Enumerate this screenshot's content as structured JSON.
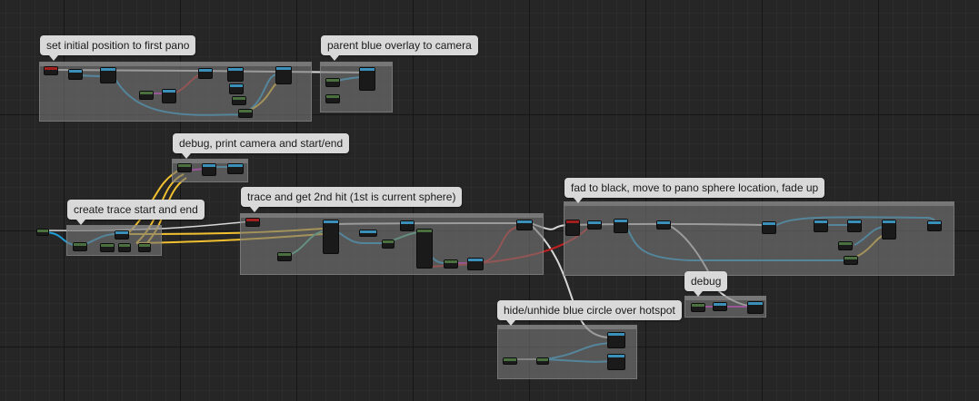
{
  "comments": [
    {
      "id": "set-initial-position",
      "label": "set initial position to first pano"
    },
    {
      "id": "parent-blue-overlay",
      "label": "parent blue overlay to camera"
    },
    {
      "id": "debug-print-camera",
      "label": "debug, print camera and start/end"
    },
    {
      "id": "create-trace",
      "label": "create trace start and end"
    },
    {
      "id": "trace-2nd-hit",
      "label": "trace and get 2nd hit (1st is current sphere)"
    },
    {
      "id": "fade-to-black",
      "label": "fad to black, move to pano sphere location, fade up"
    },
    {
      "id": "debug",
      "label": "debug"
    },
    {
      "id": "hide-unhide",
      "label": "hide/unhide blue circle over hotspot"
    }
  ],
  "colors": {
    "exec_wire": "#d8d8d8",
    "object_wire": "#1f9fd8",
    "vector_wire": "#f0c030",
    "string_wire": "#d020d0",
    "struct_wire": "#4ab890",
    "red_wire": "#c02020",
    "node_header_blue": "#3a90b8",
    "node_header_green": "#4a7040",
    "node_header_red": "#a02020"
  }
}
